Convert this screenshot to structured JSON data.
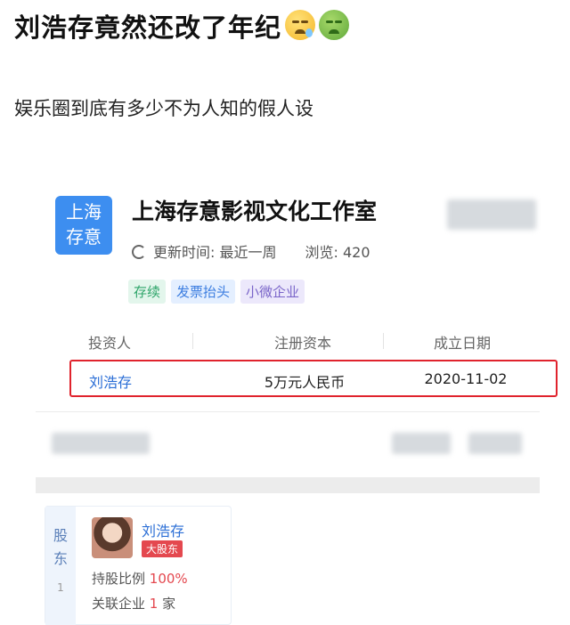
{
  "post": {
    "title": "刘浩存竟然还改了年纪",
    "emojis": [
      "sleepy-face-emoji",
      "nauseated-face-emoji"
    ],
    "subtitle": "娱乐圈到底有多少不为人知的假人设"
  },
  "company": {
    "logo_line1": "上海",
    "logo_line2": "存意",
    "name": "上海存意影视文化工作室",
    "update_label": "更新时间: 最近一周",
    "views_label": "浏览: 420",
    "tags": [
      {
        "label": "存续",
        "color": "#2fa56a"
      },
      {
        "label": "发票抬头",
        "color": "#3b7de0"
      },
      {
        "label": "小微企业",
        "color": "#7a65c9"
      }
    ]
  },
  "table": {
    "headers": [
      "投资人",
      "注册资本",
      "成立日期"
    ],
    "row": {
      "investor": "刘浩存",
      "capital": "5万元人民币",
      "date": "2020-11-02"
    },
    "highlight_color": "#e0232d"
  },
  "shareholder": {
    "side_label_1": "股",
    "side_label_2": "东",
    "side_count": "1",
    "name": "刘浩存",
    "badge": "大股东",
    "ratio_label": "持股比例",
    "ratio_value": "100%",
    "related_label": "关联企业",
    "related_value": "1",
    "related_unit": "家"
  }
}
